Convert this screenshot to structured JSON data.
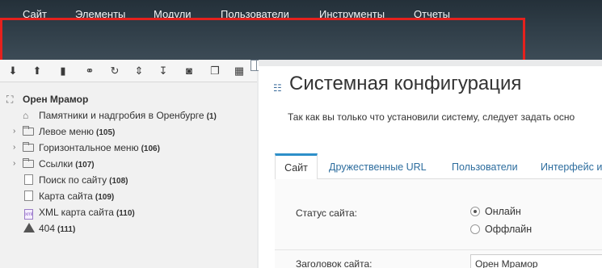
{
  "topmenu": {
    "items": [
      {
        "label": "Сайт"
      },
      {
        "label": "Элементы"
      },
      {
        "label": "Модули"
      },
      {
        "label": "Пользователи"
      },
      {
        "label": "Инструменты"
      },
      {
        "label": "Отчеты"
      }
    ]
  },
  "toolbar": {
    "icons": [
      "arrow-down-circle-icon",
      "arrow-up-circle-icon",
      "file-icon",
      "link-icon",
      "refresh-icon",
      "sort-icon",
      "sort-numeric-icon",
      "camera-icon",
      "copy-icon",
      "grid-icon"
    ]
  },
  "tree": {
    "root": {
      "label": "Орен Мрамор"
    },
    "items": [
      {
        "label": "Памятники и надгробия в Оренбурге",
        "count": "(1)"
      },
      {
        "label": "Левое меню",
        "count": "(105)"
      },
      {
        "label": "Горизонтальное меню",
        "count": "(106)"
      },
      {
        "label": "Ссылки",
        "count": "(107)"
      },
      {
        "label": "Поиск по сайту",
        "count": "(108)"
      },
      {
        "label": "Карта сайта",
        "count": "(109)"
      },
      {
        "label": "XML карта сайта",
        "count": "(110)"
      },
      {
        "label": "404",
        "count": "(111)"
      }
    ]
  },
  "main": {
    "title": "Системная конфигурация",
    "intro": "Так как вы только что установили систему, следует задать осно",
    "tabs": [
      {
        "label": "Сайт"
      },
      {
        "label": "Дружественные URL"
      },
      {
        "label": "Пользователи"
      },
      {
        "label": "Интерфейс и"
      }
    ],
    "form": {
      "status_label": "Статус сайта:",
      "online_label": "Онлайн",
      "offline_label": "Оффлайн",
      "selected_status": "Онлайн",
      "site_title_label": "Заголовок сайта:",
      "site_title_value": "Орен Мрамор"
    }
  },
  "colors": {
    "topbar": "#2f3d47",
    "highlight": "#e5211d",
    "link": "#2d6d9e",
    "active_tab_border": "#2d8fc9"
  }
}
